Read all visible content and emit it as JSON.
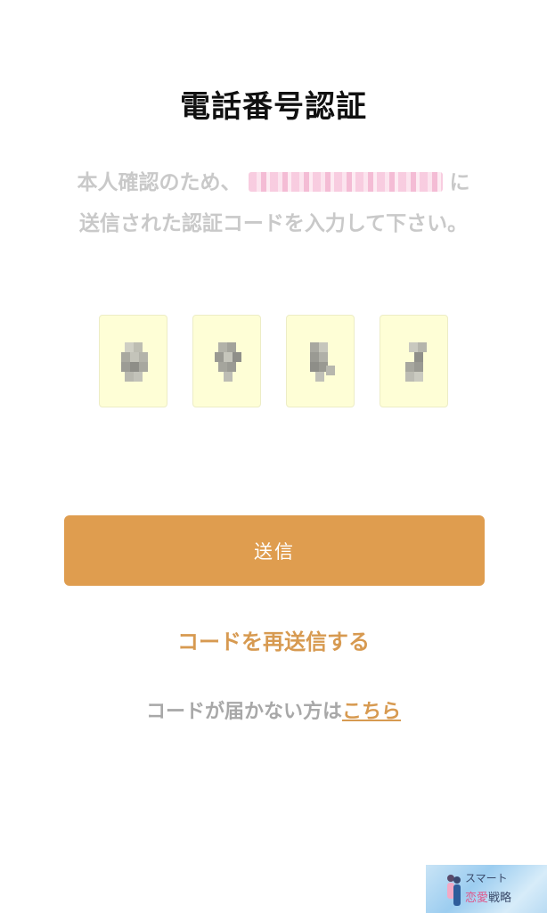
{
  "page": {
    "title": "電話番号認証",
    "description_prefix": "本人確認のため、",
    "description_suffix": "に",
    "description_line2": "送信された認証コードを入力して下さい。"
  },
  "code_inputs": {
    "count": 4,
    "box_color": "#fefed6"
  },
  "actions": {
    "send_label": "送信",
    "resend_label": "コードを再送信する",
    "help_text": "コードが届かない方は",
    "help_link": "こちら"
  },
  "watermark": {
    "line1": "スマート",
    "line2_accent": "恋愛",
    "line2_rest": "戦略"
  },
  "colors": {
    "accent": "#df9d4f",
    "link": "#d79a51",
    "title": "#111111",
    "muted": "#c9c9c9"
  }
}
